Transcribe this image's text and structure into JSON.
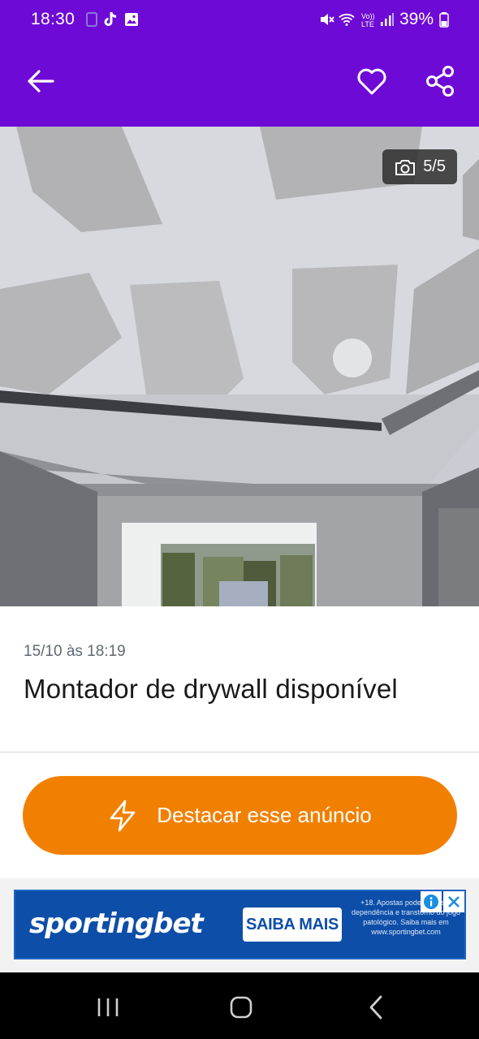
{
  "status_bar": {
    "time": "18:30",
    "battery": "39%",
    "icons": [
      "sim-icon",
      "tiktok-icon",
      "gallery-icon",
      "mute-icon",
      "wifi-icon",
      "volte-icon",
      "signal-icon",
      "battery-icon"
    ]
  },
  "app_bar": {
    "background": "#6e0ad6",
    "icons": [
      "back-arrow-icon",
      "heart-icon",
      "share-icon"
    ]
  },
  "gallery": {
    "counter": "5/5",
    "counter_icon": "camera-icon"
  },
  "listing": {
    "date": "15/10 às 18:19",
    "title": "Montador de drywall disponível"
  },
  "highlight_button": {
    "label": "Destacar esse anúncio",
    "icon": "lightning-icon",
    "color": "#f28000"
  },
  "ad": {
    "brand": "sportingbet",
    "cta": "SAIBA MAIS",
    "fine_print": "+18. Apostas podem causar dependência e transtorno do jogo patológico. Saiba mais em www.sportingbet.com",
    "icons": [
      "info-icon",
      "close-icon"
    ]
  },
  "nav_bar": {
    "icons": [
      "recents-icon",
      "home-icon",
      "back-icon"
    ]
  }
}
